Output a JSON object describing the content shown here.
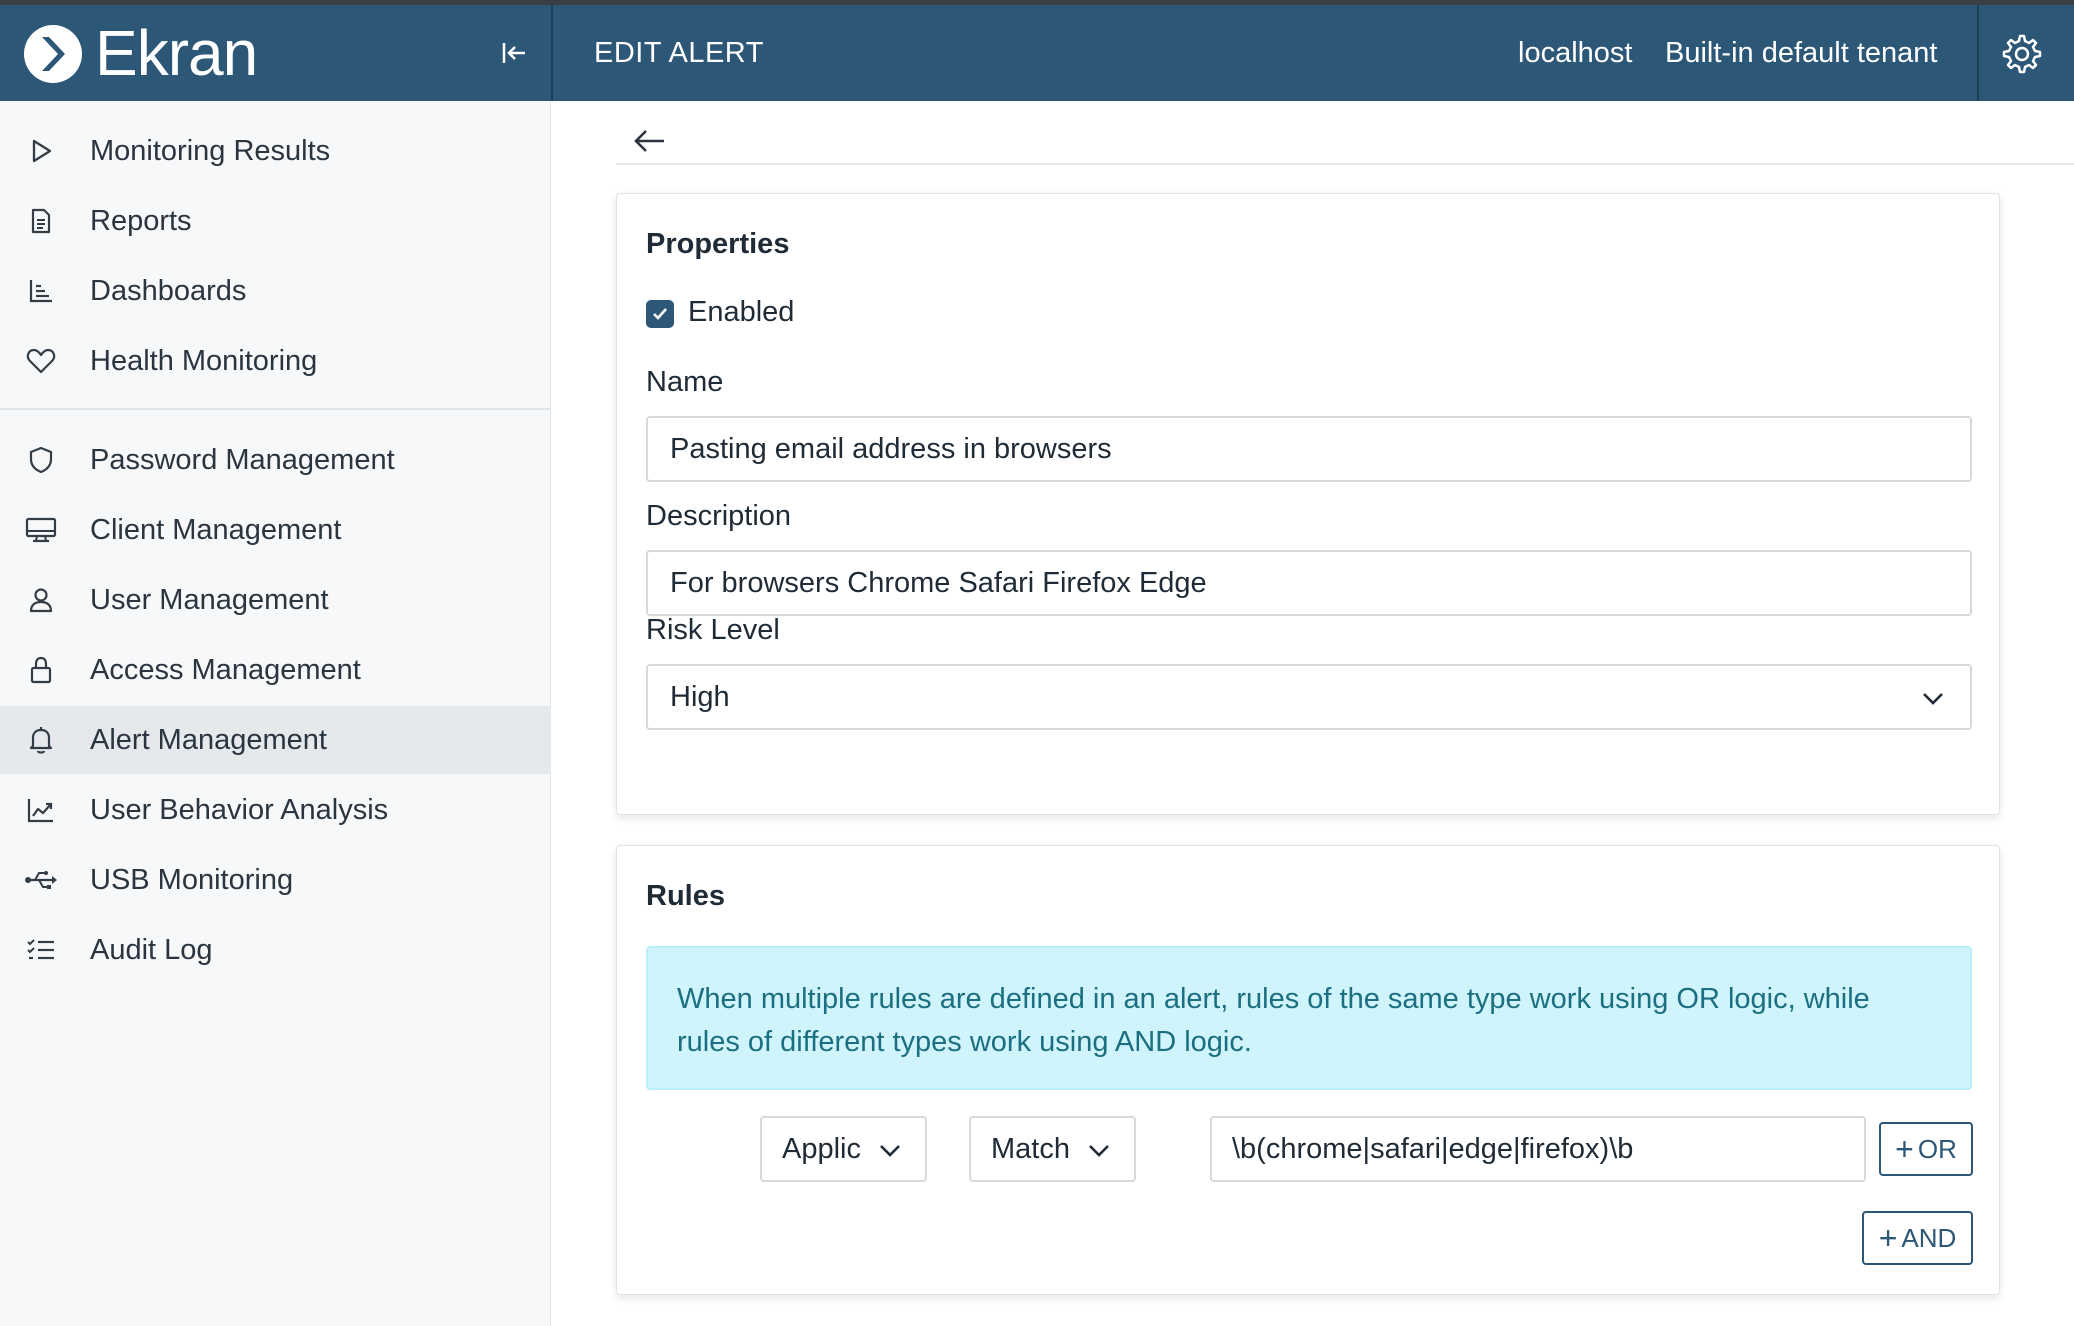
{
  "app": {
    "brand_name": "Ekran",
    "page_title": "EDIT ALERT",
    "host": "localhost",
    "tenant": "Built-in default tenant"
  },
  "sidebar": {
    "items": [
      {
        "label": "Monitoring Results",
        "icon": "play-icon"
      },
      {
        "label": "Reports",
        "icon": "document-icon"
      },
      {
        "label": "Dashboards",
        "icon": "chart-icon"
      },
      {
        "label": "Health Monitoring",
        "icon": "heart-icon"
      },
      {
        "label": "Password Management",
        "icon": "shield-icon"
      },
      {
        "label": "Client Management",
        "icon": "monitor-icon"
      },
      {
        "label": "User Management",
        "icon": "user-icon"
      },
      {
        "label": "Access Management",
        "icon": "lock-icon"
      },
      {
        "label": "Alert Management",
        "icon": "bell-icon",
        "active": true
      },
      {
        "label": "User Behavior Analysis",
        "icon": "trend-icon"
      },
      {
        "label": "USB Monitoring",
        "icon": "usb-icon"
      },
      {
        "label": "Audit Log",
        "icon": "list-icon"
      }
    ]
  },
  "properties": {
    "title": "Properties",
    "enabled_label": "Enabled",
    "enabled": true,
    "name_label": "Name",
    "name_value": "Pasting email address in browsers",
    "description_label": "Description",
    "description_value": "For browsers Chrome Safari Firefox Edge",
    "risk_label": "Risk Level",
    "risk_value": "High"
  },
  "rules": {
    "title": "Rules",
    "info": "When multiple rules are defined in an alert, rules of the same type work using OR logic, while rules of different types work using AND logic.",
    "rule": {
      "field": "Applic",
      "operator": "Match",
      "value": "\\b(chrome|safari|edge|firefox)\\b"
    },
    "or_label": "OR",
    "and_label": "AND"
  },
  "colors": {
    "header": "#2d5777",
    "sidebar_bg": "#f7f8f9",
    "active_item": "#e6e9ec",
    "info_bg": "#cff4fc",
    "info_text": "#1b6f80"
  }
}
